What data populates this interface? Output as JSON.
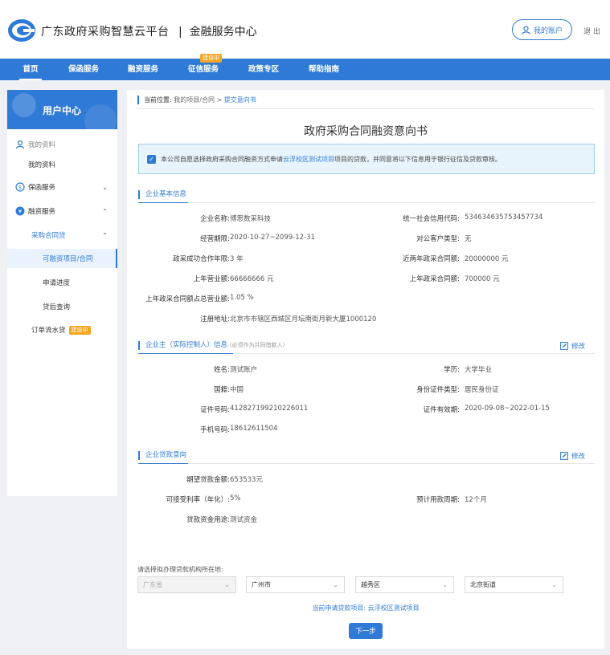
{
  "header": {
    "title": "广东政府采购智慧云平台",
    "separator": "|",
    "subtitle": "金融服务中心",
    "account_label": "我的账户",
    "logout_label": "退出"
  },
  "nav": {
    "items": [
      "首页",
      "保函服务",
      "融资服务",
      "征信服务",
      "政策专区",
      "帮助指南"
    ],
    "badge": "建设中"
  },
  "sidebar": {
    "title": "用户中心",
    "items": [
      "我的资料",
      "我的资料",
      "保函服务",
      "融资服务",
      "采购合同贷",
      "可融资项目/合同",
      "申请进度",
      "贷后查询",
      "订单流水贷"
    ],
    "badge": "建设中"
  },
  "breadcrumb": {
    "label": "当前位置:",
    "path": "我的项目/合同 >",
    "current": "提交意向书"
  },
  "page_title": "政府采购合同融资意向书",
  "notice": {
    "pre": "本公司自愿选择政府采购合同融资方式申请",
    "project": "云浮校区测试项目",
    "post": "项目的贷款，并同意将以下信息用于银行征信及贷款审核。"
  },
  "company": {
    "section_title": "企业基本信息",
    "fields": [
      {
        "label": "企业名称:",
        "value": "博思数采科技"
      },
      {
        "label": "统一社会信用代码:",
        "value": "534634635753457734"
      },
      {
        "label": "经营期限:",
        "value": "2020-10-27~2099-12-31"
      },
      {
        "label": "对公客户类型:",
        "value": "无"
      },
      {
        "label": "政采成功合作年限:",
        "value": "3 年"
      },
      {
        "label": "近两年政采合同额:",
        "value": "20000000 元"
      },
      {
        "label": "上年营业额:",
        "value": "66666666 元"
      },
      {
        "label": "上年政采合同额:",
        "value": "700000 元"
      },
      {
        "label": "上年政采合同额占总营业额:",
        "value": "1.05 %"
      },
      {
        "label": "注册地址:",
        "value": "北京市市辖区西城区月坛南街月新大厦1000120"
      }
    ]
  },
  "owner": {
    "section_title": "企业主（实际控制人）信息",
    "note": "(必须作为共同借款人)",
    "edit_label": "修改",
    "fields": [
      {
        "label": "姓名:",
        "value": "测试账户"
      },
      {
        "label": "学历:",
        "value": "大学毕业"
      },
      {
        "label": "国籍:",
        "value": "中国"
      },
      {
        "label": "身份证件类型:",
        "value": "居民身份证"
      },
      {
        "label": "证件号码:",
        "value": "412827199210226011"
      },
      {
        "label": "证件有效期:",
        "value": "2020-09-08~2022-01-15"
      },
      {
        "label": "手机号码:",
        "value": "18612611504"
      }
    ]
  },
  "loan": {
    "section_title": "企业贷款意向",
    "edit_label": "修改",
    "fields": [
      {
        "label": "期望贷款金额:",
        "value": "653533元"
      },
      {
        "label": "可接受利率（年化）:",
        "value": "5%"
      },
      {
        "label": "预计用款周期:",
        "value": "12个月"
      },
      {
        "label": "贷款资金用途:",
        "value": "测试资金"
      }
    ]
  },
  "location": {
    "label": "请选择拟办理贷款机构所在地:",
    "province": "广东省",
    "city": "广州市",
    "district": "越秀区",
    "street": "北京街道"
  },
  "current_project": "当前申请贷款项目: 云浮校区测试项目",
  "next_label": "下一步",
  "colors": {
    "primary": "#2f7ad6",
    "badge": "#f5a623"
  }
}
